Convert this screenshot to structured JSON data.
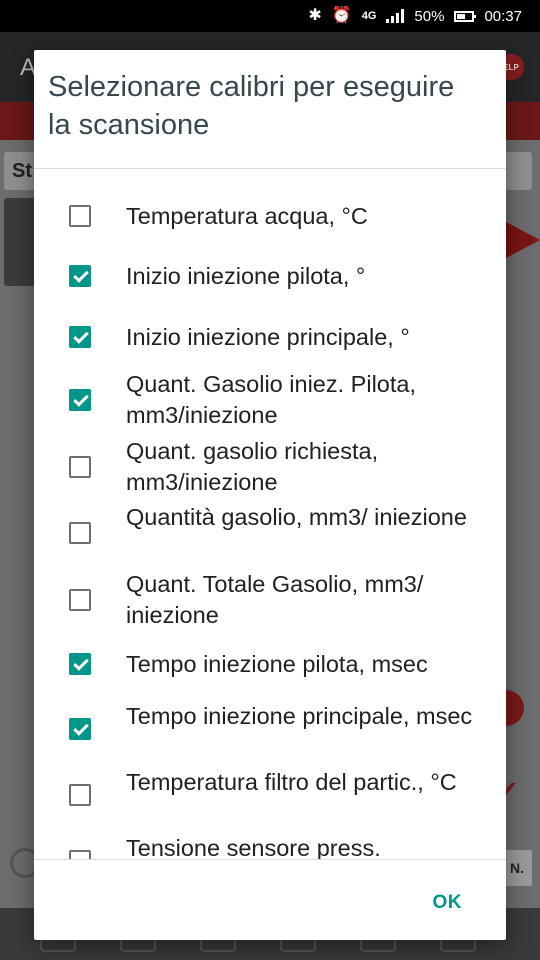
{
  "status_bar": {
    "battery_percent": "50%",
    "time": "00:37",
    "network": "4G",
    "icons": [
      "bluetooth-icon",
      "alarm-icon",
      "signal-icon",
      "battery-icon"
    ]
  },
  "background_app": {
    "toolbar_letter": "A",
    "help_badge": "ELP",
    "field_text": "St",
    "side_button": "N."
  },
  "dialog": {
    "title": "Selezionare calibri per eseguire la scansione",
    "ok_label": "OK",
    "items": [
      {
        "label": "Temperatura acqua, °C",
        "checked": false
      },
      {
        "label": "Inizio iniezione pilota, °",
        "checked": true
      },
      {
        "label": "Inizio iniezione principale, °",
        "checked": true
      },
      {
        "label": "Quant. Gasolio iniez. Pilota, mm3/iniezione",
        "checked": true
      },
      {
        "label": "Quant. gasolio richiesta, mm3/iniezione",
        "checked": false
      },
      {
        "label": "Quantità gasolio, mm3/ iniezione",
        "checked": false
      },
      {
        "label": "Quant. Totale Gasolio, mm3/ iniezione",
        "checked": false
      },
      {
        "label": "Tempo iniezione pilota, msec",
        "checked": true
      },
      {
        "label": "Tempo iniezione principale, msec",
        "checked": true
      },
      {
        "label": "Temperatura filtro del partic., °C",
        "checked": false
      },
      {
        "label": "Tensione sensore press.",
        "checked": false
      }
    ]
  },
  "colors": {
    "accent": "#009688",
    "title_text": "#37474f",
    "status_bar": "#000000"
  }
}
